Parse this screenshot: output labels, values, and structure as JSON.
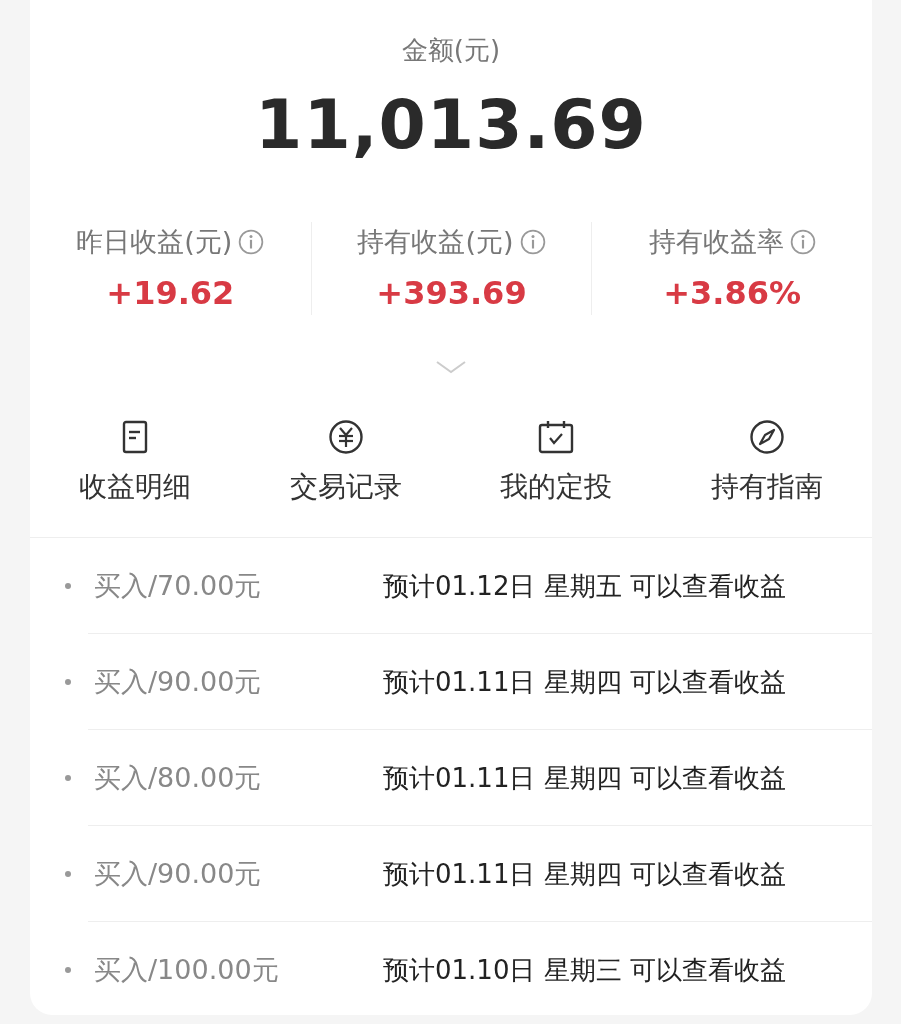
{
  "balance": {
    "label": "金额(元)",
    "amount": "11,013.69"
  },
  "stats": [
    {
      "label": "昨日收益(元)",
      "value": "+19.62"
    },
    {
      "label": "持有收益(元)",
      "value": "+393.69"
    },
    {
      "label": "持有收益率",
      "value": "+3.86%"
    }
  ],
  "actions": [
    {
      "label": "收益明细"
    },
    {
      "label": "交易记录"
    },
    {
      "label": "我的定投"
    },
    {
      "label": "持有指南"
    }
  ],
  "records": [
    {
      "amount": "买入/70.00元",
      "note": "预计01.12日 星期五 可以查看收益"
    },
    {
      "amount": "买入/90.00元",
      "note": "预计01.11日 星期四 可以查看收益"
    },
    {
      "amount": "买入/80.00元",
      "note": "预计01.11日 星期四 可以查看收益"
    },
    {
      "amount": "买入/90.00元",
      "note": "预计01.11日 星期四 可以查看收益"
    },
    {
      "amount": "买入/100.00元",
      "note": "预计01.10日 星期三 可以查看收益"
    }
  ]
}
